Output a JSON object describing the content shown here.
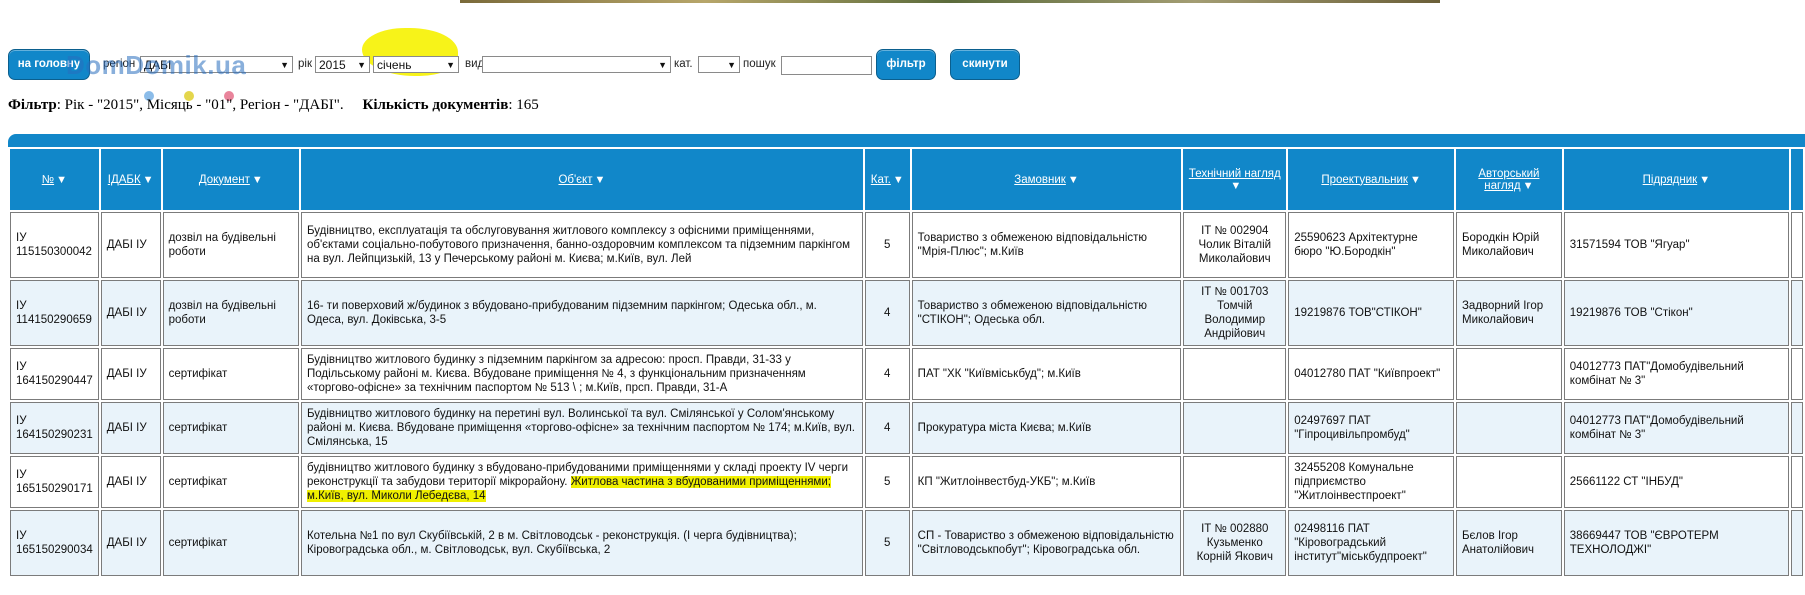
{
  "filters": {
    "home_label": "на головну",
    "region_label": "регіон",
    "region_value": "ДАБІ",
    "year_label": "рік",
    "year_value": "2015",
    "month_value": "січень",
    "type_label": "вид",
    "type_value": "",
    "category_label": "кат.",
    "category_value": "",
    "search_label": "пошук",
    "search_value": "",
    "filter_button": "фільтр",
    "reset_button": "скинути"
  },
  "watermark": "DomDomik.ua",
  "summary": {
    "filter_label": "Фільтр",
    "filter_text": ": Рік - \"2015\", Місяць - \"01\", Регіон - \"ДАБІ\".",
    "count_label": "Кількість документів",
    "count_value": ": 165"
  },
  "table": {
    "columns": [
      {
        "label": "№",
        "sort": "▼"
      },
      {
        "label": "ІДАБК",
        "sort": "▼"
      },
      {
        "label": "Документ",
        "sort": "▼"
      },
      {
        "label": "Об'єкт",
        "sort": "▼"
      },
      {
        "label": "Кат.",
        "sort": "▼"
      },
      {
        "label": "Замовник",
        "sort": "▼"
      },
      {
        "label": "Технічний нагляд",
        "sort": "▼"
      },
      {
        "label": "Проектувальник",
        "sort": "▼"
      },
      {
        "label": "Авторський нагляд",
        "sort": "▼"
      },
      {
        "label": "Підрядник",
        "sort": "▼"
      }
    ],
    "rows": [
      {
        "num": "ІУ 115150300042",
        "idabk": "ДАБІ ІУ",
        "doc": "дозвіл на будівельні роботи",
        "object": "Будівництво, експлуатація та обслуговування житлового комплексу з офісними приміщеннями, об'єктами соціально-побутового призначення, банно-оздоровчим комплексом та підземним паркінгом на вул. Лейпцизькій, 13 у Печерському районі м. Києва; м.Київ, вул. Лей",
        "cat": "5",
        "customer": "Товариство з обмеженою відповідальністю \"Мрія-Плюс\"; м.Київ",
        "tech": "ІТ № 002904 Чолик Віталій Миколайович",
        "designer": "25590623 Архітектурне бюро \"Ю.Бородкін\"",
        "author": "Бородкін Юрій Миколайович",
        "contractor": "31571594 ТОВ \"Ягуар\""
      },
      {
        "num": "ІУ 114150290659",
        "idabk": "ДАБІ ІУ",
        "doc": "дозвіл на будівельні роботи",
        "object": "16- ти поверховий ж/будинок з вбудовано-прибудованим підземним паркінгом; Одеська обл., м. Одеса, вул. Доківська, 3-5",
        "cat": "4",
        "customer": "Товариство з обмеженою відповідальністю \"СТІКОН\"; Одеська обл.",
        "tech": "ІТ № 001703 Томчій Володимир Андрійович",
        "designer": "19219876 ТОВ\"СТІКОН\"",
        "author": "Задворний Ігор Миколайович",
        "contractor": "19219876 ТОВ \"Стікон\""
      },
      {
        "num": "ІУ 164150290447",
        "idabk": "ДАБІ ІУ",
        "doc": "сертифікат",
        "object": "Будівництво житлового будинку з підземним паркінгом за адресою: просп. Правди, 31-33 у Подільському районі м. Києва. Вбудоване приміщення № 4, з функціональним призначенням «торгово-офісне» за технічним паспортом № 513 \\ ; м.Київ, прсп. Правди, 31-А",
        "cat": "4",
        "customer": "ПАТ \"ХК \"Київміськбуд\"; м.Київ",
        "tech": "",
        "designer": "04012780 ПАТ \"Київпроект\"",
        "author": "",
        "contractor": "04012773 ПАТ\"Домобудівельний комбінат № 3\""
      },
      {
        "num": "ІУ 164150290231",
        "idabk": "ДАБІ ІУ",
        "doc": "сертифікат",
        "object": "Будівництво житлового будинку на перетині вул. Волинської та вул. Смілянської у Солом'янському районі м. Києва. Вбудоване приміщення «торгово-офісне» за технічним паспортом № 174; м.Київ, вул. Смілянська, 15",
        "cat": "4",
        "customer": "Прокуратура міста Києва; м.Київ",
        "tech": "",
        "designer": "02497697 ПАТ \"Гіпроцивільпромбуд\"",
        "author": "",
        "contractor": "04012773 ПАТ\"Домобудівельний комбінат № 3\""
      },
      {
        "num": "ІУ 165150290171",
        "idabk": "ДАБІ ІУ",
        "doc": "сертифікат",
        "object_pre": "будівництво житлового будинку з вбудовано-прибудованими приміщеннями у складі проекту IV черги реконструкції та забудови території мікрорайону. ",
        "object_hl": "Житлова частина з вбудованими приміщеннями; м.Київ, вул. Миколи Лебедєва, 14",
        "cat": "5",
        "customer": "КП \"Житлоінвестбуд-УКБ\"; м.Київ",
        "tech": "",
        "designer": "32455208 Комунальне підприємство \"Житлоінвестпроект\"",
        "author": "",
        "contractor": "25661122 СТ \"ІНБУД\""
      },
      {
        "num": "ІУ 165150290034",
        "idabk": "ДАБІ ІУ",
        "doc": "сертифікат",
        "object": "Котельна №1 по вул Скубіївській, 2 в м. Світловодськ - реконструкція. (І черга будівництва); Кіровоградська обл., м. Світловодськ, вул. Скубіївська, 2",
        "cat": "5",
        "customer": "СП - Товариство з обмеженою відповідальністю \"Світловодськпобут\"; Кіровоградська обл.",
        "tech": "ІТ № 002880 Кузьменко Корній Якович",
        "designer": "02498116 ПАТ \"Кіровоградський інститут\"міськбудпроект\"",
        "author": "Бєлов Ігор Анатолійович",
        "contractor": "38669447 ТОВ \"ЄВРОТЕРМ ТЕХНОЛОДЖІ\""
      }
    ]
  },
  "colors": {
    "accent": "#1187c9",
    "highlight": "#f0f000"
  }
}
